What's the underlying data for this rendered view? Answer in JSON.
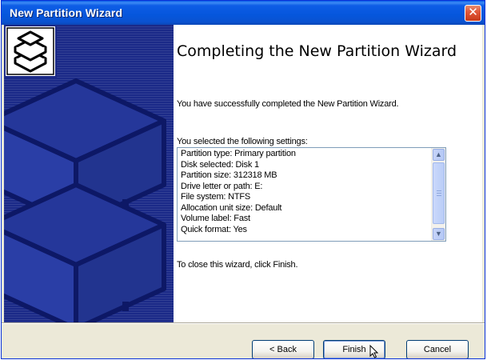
{
  "window": {
    "title": "New Partition Wizard",
    "close_glyph": "✕"
  },
  "banner": {
    "icon": "partition-wizard-icon"
  },
  "page": {
    "heading": "Completing the New Partition Wizard",
    "success_message": "You have successfully completed the New Partition Wizard.",
    "settings_label": "You selected the following settings:",
    "settings": [
      "Partition type: Primary partition",
      "Disk selected: Disk 1",
      "Partition size: 312318 MB",
      "Drive letter or path: E:",
      "File system: NTFS",
      "Allocation unit size: Default",
      "Volume label: Fast",
      "Quick format: Yes"
    ],
    "close_hint": "To close this wizard, click Finish."
  },
  "buttons": {
    "back": "< Back",
    "finish": "Finish",
    "cancel": "Cancel"
  },
  "colors": {
    "titlebar": "#0556dc",
    "banner": "#1b2a88"
  }
}
